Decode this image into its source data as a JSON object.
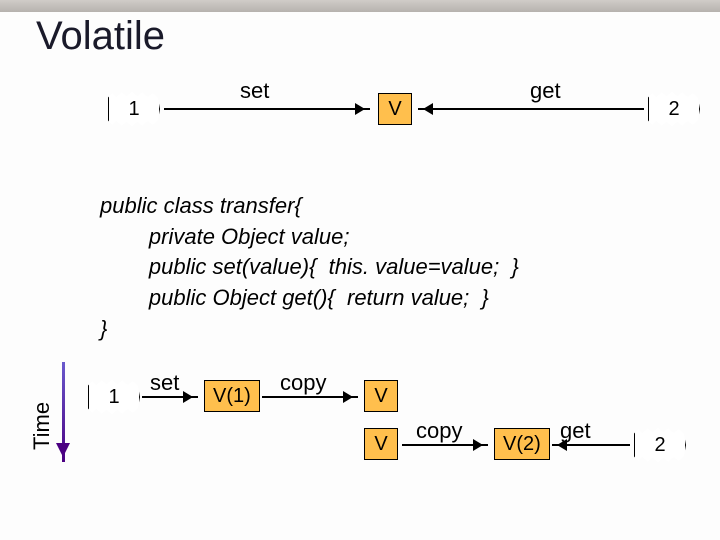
{
  "title": "Volatile",
  "row1": {
    "thread_left": "1",
    "op_set": "set",
    "var": "V",
    "op_get": "get",
    "thread_right": "2"
  },
  "code": {
    "l1": "public class transfer{",
    "l2": "        private Object value;",
    "l3": "        public set(value){  this. value=value;  }",
    "l4": "        public Object get(){  return value;  }",
    "l5": "}"
  },
  "time_label": "Time",
  "row2a": {
    "thread_left": "1",
    "op_set": "set",
    "var_local": "V(1)",
    "op_copy": "copy",
    "var": "V"
  },
  "row2b": {
    "var": "V",
    "op_copy": "copy",
    "var_local": "V(2)",
    "op_get": "get",
    "thread_right": "2"
  }
}
